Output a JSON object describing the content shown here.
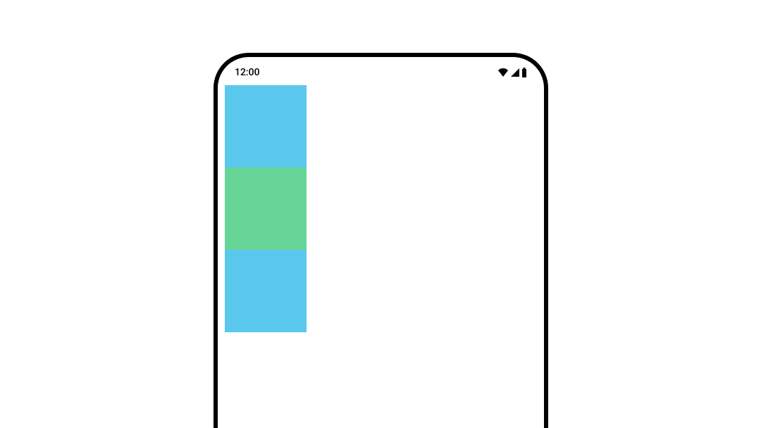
{
  "statusBar": {
    "time": "12:00"
  },
  "blocks": [
    {
      "color": "#5ac8ed",
      "name": "blue"
    },
    {
      "color": "#67d598",
      "name": "green"
    },
    {
      "color": "#5ac8ed",
      "name": "blue"
    }
  ]
}
